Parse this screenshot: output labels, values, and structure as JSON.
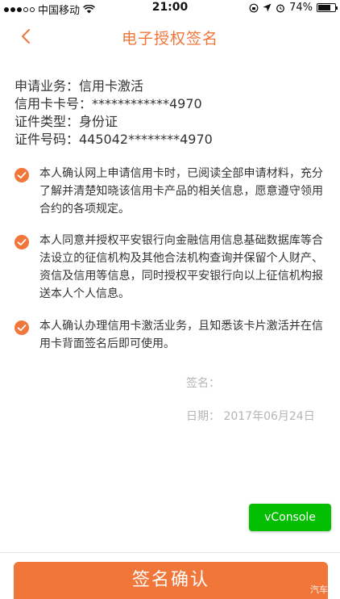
{
  "status_bar": {
    "carrier": "中国移动",
    "time": "21:00",
    "battery": "74%",
    "battery_level": 0.74
  },
  "nav": {
    "title": "电子授权签名"
  },
  "info": {
    "business": "申请业务：信用卡激活",
    "card_number": "信用卡卡号：************4970",
    "id_type": "证件类型：身份证",
    "id_number": "证件号码：445042********4970"
  },
  "agreements": [
    {
      "text": "本人确认网上申请信用卡时，已阅读全部申请材料，充分了解并清楚知晓该信用卡产品的相关信息，愿意遵守领用合约的各项规定。",
      "checked": true
    },
    {
      "text": "本人同意并授权平安银行向金融信用信息基础数据库等合法设立的征信机构及其他合法机构查询并保留个人财产、资信及信用等信息，同时授权平安银行向以上征信机构报送本人个人信息。",
      "checked": true
    },
    {
      "text": "本人确认办理信用卡激活业务，且知悉该卡片激活并在信用卡背面签名后即可使用。",
      "checked": true
    }
  ],
  "signature": {
    "label": "签名：",
    "date": "日期： 2017年06月24日"
  },
  "vconsole_label": "vConsole",
  "confirm_label": "签名确认",
  "watermark": "汽车之",
  "colors": {
    "accent": "#f0763a",
    "vconsole": "#04be02",
    "muted": "#b5b5b5"
  }
}
